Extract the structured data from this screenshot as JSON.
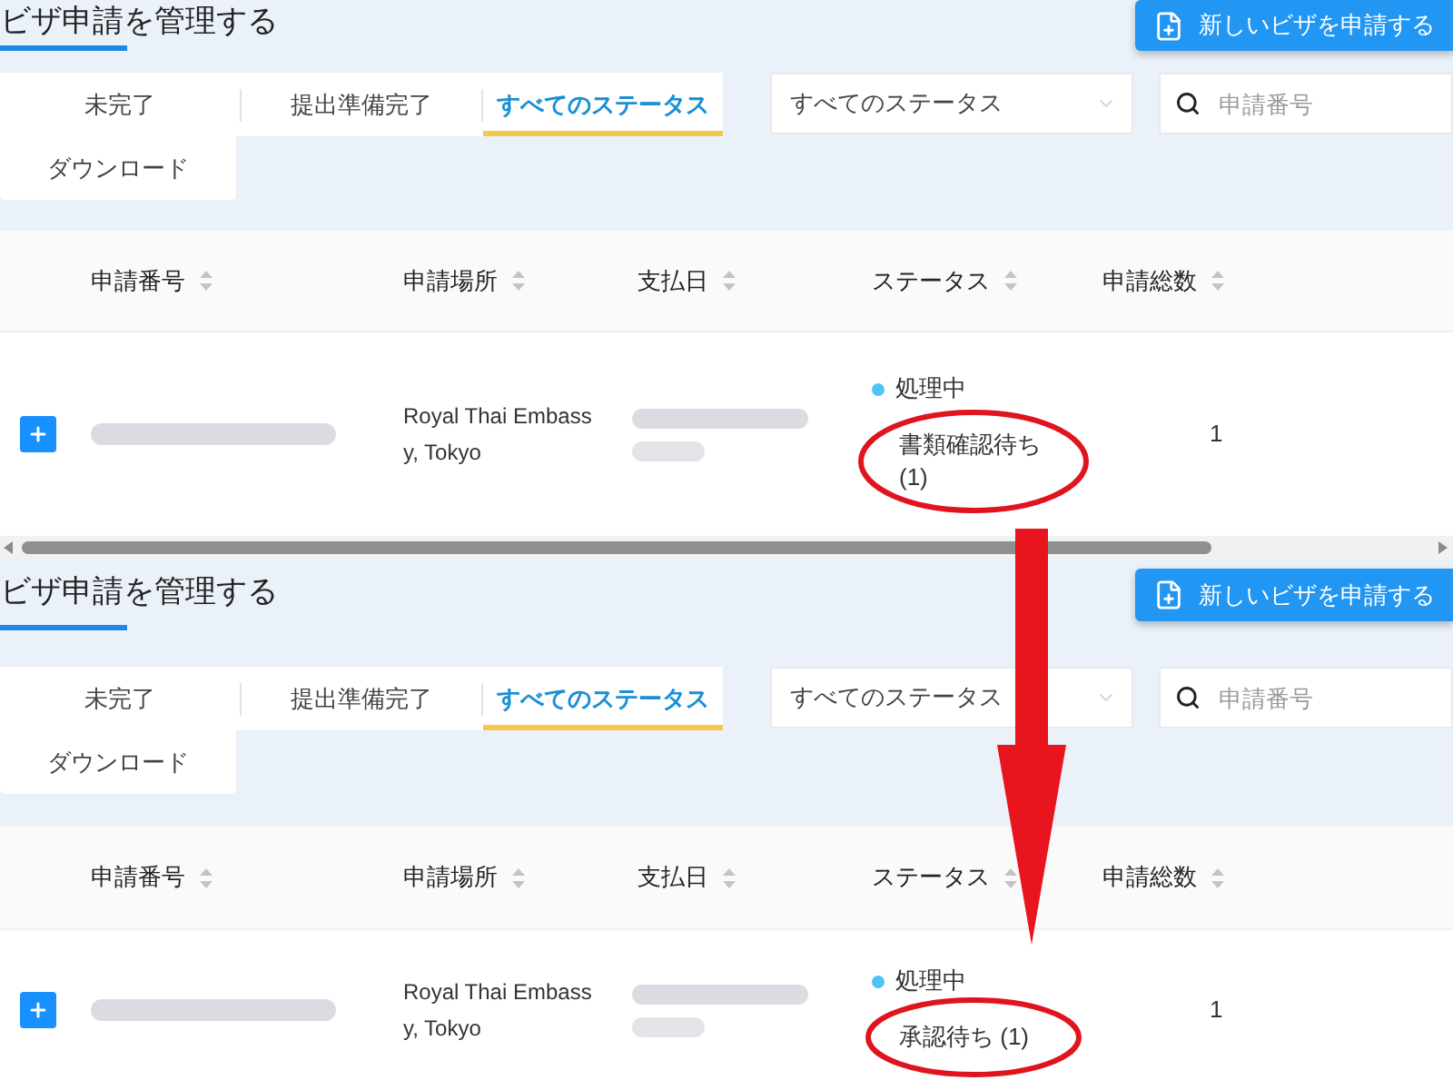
{
  "panels": [
    {
      "title": "ビザ申請を管理する",
      "new_button": "新しいビザを申請する",
      "tabs": [
        {
          "label": "未完了",
          "selected": false
        },
        {
          "label": "提出準備完了",
          "selected": false
        },
        {
          "label": "すべてのステータス",
          "selected": true
        }
      ],
      "download_button": "ダウンロード",
      "status_filter": {
        "value": "すべてのステータス"
      },
      "search": {
        "placeholder": "申請番号"
      },
      "table": {
        "columns": [
          "申請番号",
          "申請場所",
          "支払日",
          "ステータス",
          "申請総数"
        ],
        "rows": [
          {
            "place": "Royal Thai Embassy, Tokyo",
            "status": "処理中",
            "detail": "書類確認待ち (1)",
            "total": "1"
          }
        ]
      },
      "horizontal_scrollbar": true
    },
    {
      "title": "ビザ申請を管理する",
      "new_button": "新しいビザを申請する",
      "tabs": [
        {
          "label": "未完了",
          "selected": false
        },
        {
          "label": "提出準備完了",
          "selected": false
        },
        {
          "label": "すべてのステータス",
          "selected": true
        }
      ],
      "download_button": "ダウンロード",
      "status_filter": {
        "value": "すべてのステータス"
      },
      "search": {
        "placeholder": "申請番号"
      },
      "table": {
        "columns": [
          "申請番号",
          "申請場所",
          "支払日",
          "ステータス",
          "申請総数"
        ],
        "rows": [
          {
            "place": "Royal Thai Embassy, Tokyo",
            "status": "処理中",
            "detail": "承認待ち (1)",
            "total": "1"
          }
        ]
      }
    }
  ]
}
